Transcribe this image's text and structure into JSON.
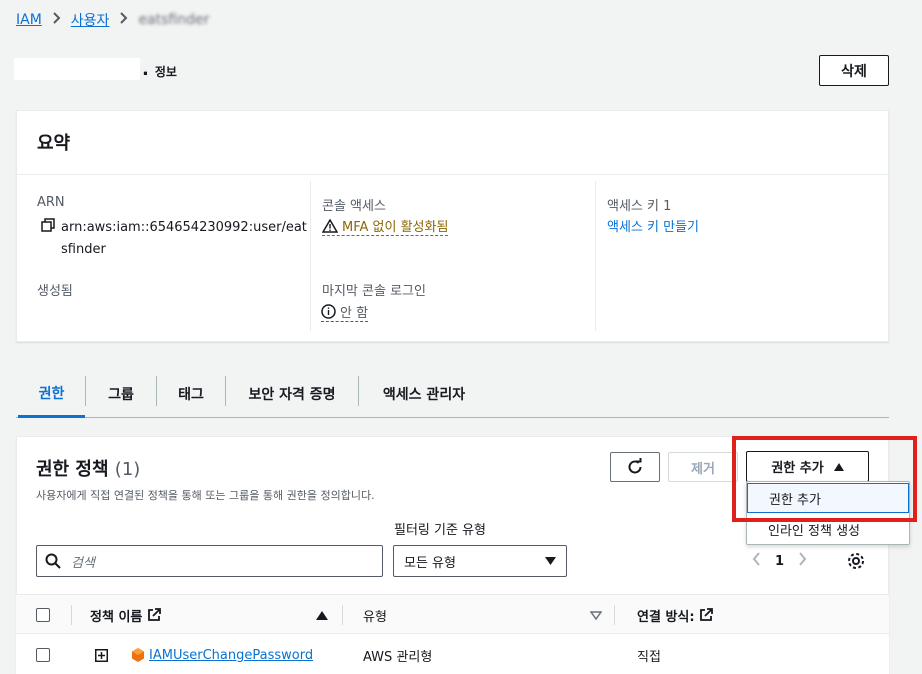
{
  "breadcrumb": {
    "root": "IAM",
    "users": "사용자",
    "current": "eatsfinder"
  },
  "header": {
    "info_link": "정보",
    "delete_button": "삭제"
  },
  "summary": {
    "title": "요약",
    "arn_label": "ARN",
    "arn_line1": "arn:aws:iam::654654230992:user/eat",
    "arn_line2": "sfinder",
    "created_label": "생성됨",
    "console_access_label": "콘솔 액세스",
    "console_access_value": "MFA 없이 활성화됨",
    "last_login_label": "마지막 콘솔 로그인",
    "last_login_value": "안 함",
    "access_key_label": "액세스 키 1",
    "access_key_link": "액세스 키 만들기"
  },
  "tabs": [
    {
      "label": "권한"
    },
    {
      "label": "그룹"
    },
    {
      "label": "태그"
    },
    {
      "label": "보안 자격 증명"
    },
    {
      "label": "액세스 관리자"
    }
  ],
  "permissions": {
    "title": "권한 정책",
    "count": "(1)",
    "description": "사용자에게 직접 연결된 정책을 통해 또는 그룹을 통해 권한을 정의합니다.",
    "remove_button": "제거",
    "add_button": "권한 추가",
    "dropdown_items": [
      "권한 추가",
      "인라인 정책 생성"
    ],
    "filter_label": "필터링 기준 유형",
    "search_placeholder": "검색",
    "select_value": "모든 유형",
    "page": "1",
    "columns": [
      "정책 이름",
      "유형",
      "연결 방식:"
    ],
    "rows": [
      {
        "name": "IAMUserChangePassword",
        "type": "AWS 관리형",
        "attached": "직접"
      }
    ]
  },
  "colors": {
    "link": "#0972d3",
    "warning": "#8d6605",
    "highlight_box": "#e0201a"
  }
}
